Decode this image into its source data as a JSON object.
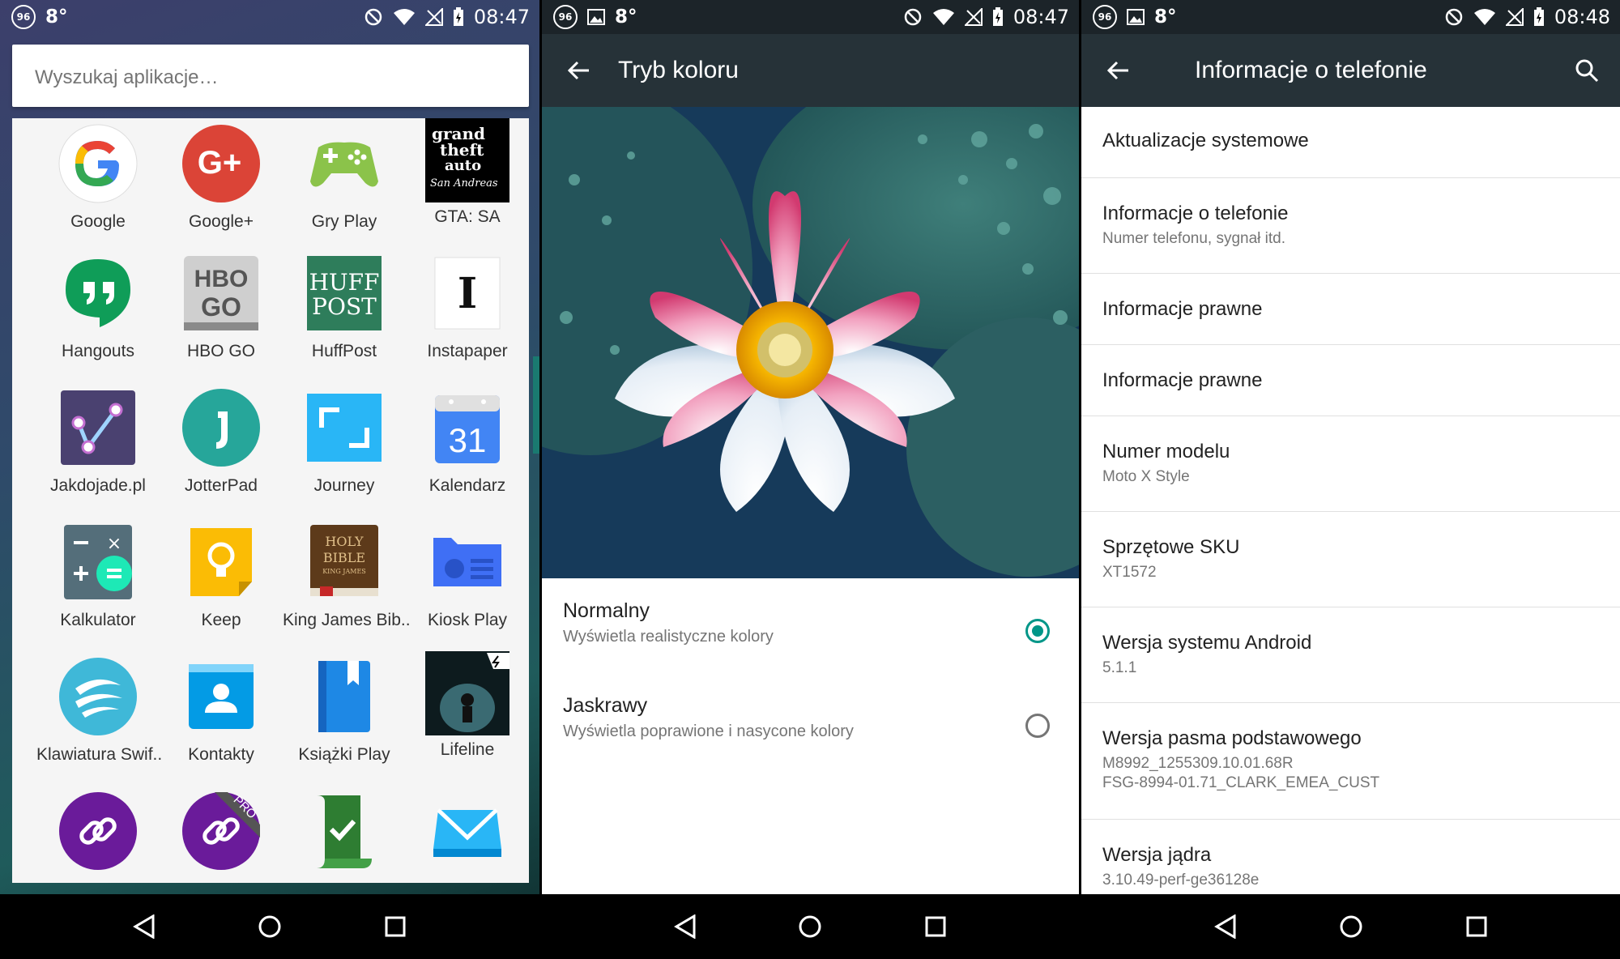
{
  "status_bars": [
    {
      "badge": "96",
      "temp": "8°",
      "time": "08:47"
    },
    {
      "badge": "96",
      "temp": "8°",
      "time": "08:47"
    },
    {
      "badge": "96",
      "temp": "8°",
      "time": "08:48"
    }
  ],
  "app_drawer": {
    "search_placeholder": "Wyszukaj aplikacje…",
    "apps": [
      {
        "label": "Google",
        "icon": "google-icon"
      },
      {
        "label": "Google+",
        "icon": "google-plus-icon"
      },
      {
        "label": "Gry Play",
        "icon": "play-games-icon"
      },
      {
        "label": "GTA: SA",
        "icon": "gta-sa-icon"
      },
      {
        "label": "Hangouts",
        "icon": "hangouts-icon"
      },
      {
        "label": "HBO GO",
        "icon": "hbo-go-icon"
      },
      {
        "label": "HuffPost",
        "icon": "huffpost-icon"
      },
      {
        "label": "Instapaper",
        "icon": "instapaper-icon"
      },
      {
        "label": "Jakdojade.pl",
        "icon": "jakdojade-icon"
      },
      {
        "label": "JotterPad",
        "icon": "jotterpad-icon"
      },
      {
        "label": "Journey",
        "icon": "journey-icon"
      },
      {
        "label": "Kalendarz",
        "icon": "calendar-icon"
      },
      {
        "label": "Kalkulator",
        "icon": "calculator-icon"
      },
      {
        "label": "Keep",
        "icon": "keep-icon"
      },
      {
        "label": "King James Bib..",
        "icon": "bible-icon"
      },
      {
        "label": "Kiosk Play",
        "icon": "kiosk-play-icon"
      },
      {
        "label": "Klawiatura Swif..",
        "icon": "swiftkey-icon"
      },
      {
        "label": "Kontakty",
        "icon": "contacts-icon"
      },
      {
        "label": "Książki Play",
        "icon": "play-books-icon"
      },
      {
        "label": "Lifeline",
        "icon": "lifeline-icon"
      },
      {
        "label": "",
        "icon": "link-icon"
      },
      {
        "label": "",
        "icon": "link-pro-icon"
      },
      {
        "label": "",
        "icon": "tasks-icon"
      },
      {
        "label": "",
        "icon": "mailbox-icon"
      }
    ],
    "icon_texts": {
      "gta": [
        "grand",
        "theft",
        "auto",
        "San Andreas"
      ],
      "hbo": [
        "HBO",
        "GO"
      ],
      "huff": [
        "HUFF",
        "POST"
      ],
      "insta": "I",
      "cal": "31",
      "bible": [
        "HOLY",
        "BIBLE",
        "KING JAMES"
      ],
      "pro": "PRO"
    }
  },
  "color_mode": {
    "title": "Tryb koloru",
    "options": [
      {
        "title": "Normalny",
        "subtitle": "Wyświetla realistyczne kolory",
        "selected": true
      },
      {
        "title": "Jaskrawy",
        "subtitle": "Wyświetla poprawione i nasycone kolory",
        "selected": false
      }
    ]
  },
  "phone_info": {
    "title": "Informacje o telefonie",
    "items": [
      {
        "title": "Aktualizacje systemowe",
        "lines": []
      },
      {
        "title": "Informacje o telefonie",
        "lines": [
          "Numer telefonu, sygnał itd."
        ]
      },
      {
        "title": "Informacje prawne",
        "lines": []
      },
      {
        "title": "Informacje prawne",
        "lines": []
      },
      {
        "title": "Numer modelu",
        "lines": [
          "Moto X Style"
        ]
      },
      {
        "title": "Sprzętowe SKU",
        "lines": [
          "XT1572"
        ]
      },
      {
        "title": "Wersja systemu Android",
        "lines": [
          "5.1.1"
        ]
      },
      {
        "title": "Wersja pasma podstawowego",
        "lines": [
          "M8992_1255309.10.01.68R",
          "FSG-8994-01.71_CLARK_EMEA_CUST"
        ]
      },
      {
        "title": "Wersja jądra",
        "lines": [
          "3.10.49-perf-ge36128e"
        ]
      }
    ]
  },
  "colors": {
    "accent": "#009688",
    "toolbar": "#263238"
  }
}
